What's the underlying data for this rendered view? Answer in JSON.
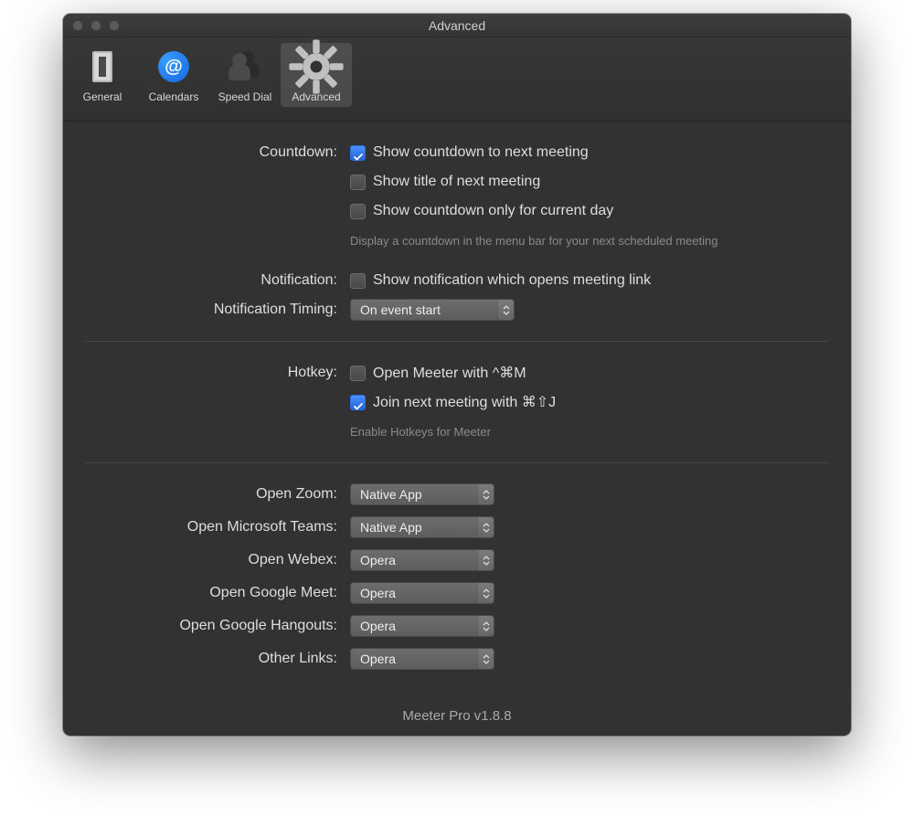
{
  "window": {
    "title": "Advanced"
  },
  "toolbar": {
    "general": "General",
    "calendars": "Calendars",
    "speed_dial": "Speed Dial",
    "advanced": "Advanced"
  },
  "countdown": {
    "label": "Countdown:",
    "show_countdown": "Show countdown to next meeting",
    "show_title": "Show title of next meeting",
    "show_current_day": "Show countdown only for current day",
    "hint": "Display a countdown in the menu bar for your next scheduled meeting"
  },
  "notification": {
    "label": "Notification:",
    "show_notification": "Show notification which opens meeting link",
    "timing_label": "Notification Timing:",
    "timing_value": "On event start"
  },
  "hotkey": {
    "label": "Hotkey:",
    "open_meeter": "Open Meeter with ^⌘M",
    "join_next": "Join next meeting with ⌘⇧J",
    "hint": "Enable Hotkeys for Meeter"
  },
  "apps": {
    "zoom_label": "Open Zoom:",
    "zoom_value": "Native App",
    "teams_label": "Open Microsoft Teams:",
    "teams_value": "Native App",
    "webex_label": "Open Webex:",
    "webex_value": "Opera",
    "meet_label": "Open Google Meet:",
    "meet_value": "Opera",
    "hangouts_label": "Open Google Hangouts:",
    "hangouts_value": "Opera",
    "other_label": "Other Links:",
    "other_value": "Opera"
  },
  "footer": "Meeter Pro v1.8.8",
  "checks": {
    "show_countdown": true,
    "show_title": false,
    "show_current_day": false,
    "show_notification": false,
    "open_meeter": false,
    "join_next": true
  }
}
